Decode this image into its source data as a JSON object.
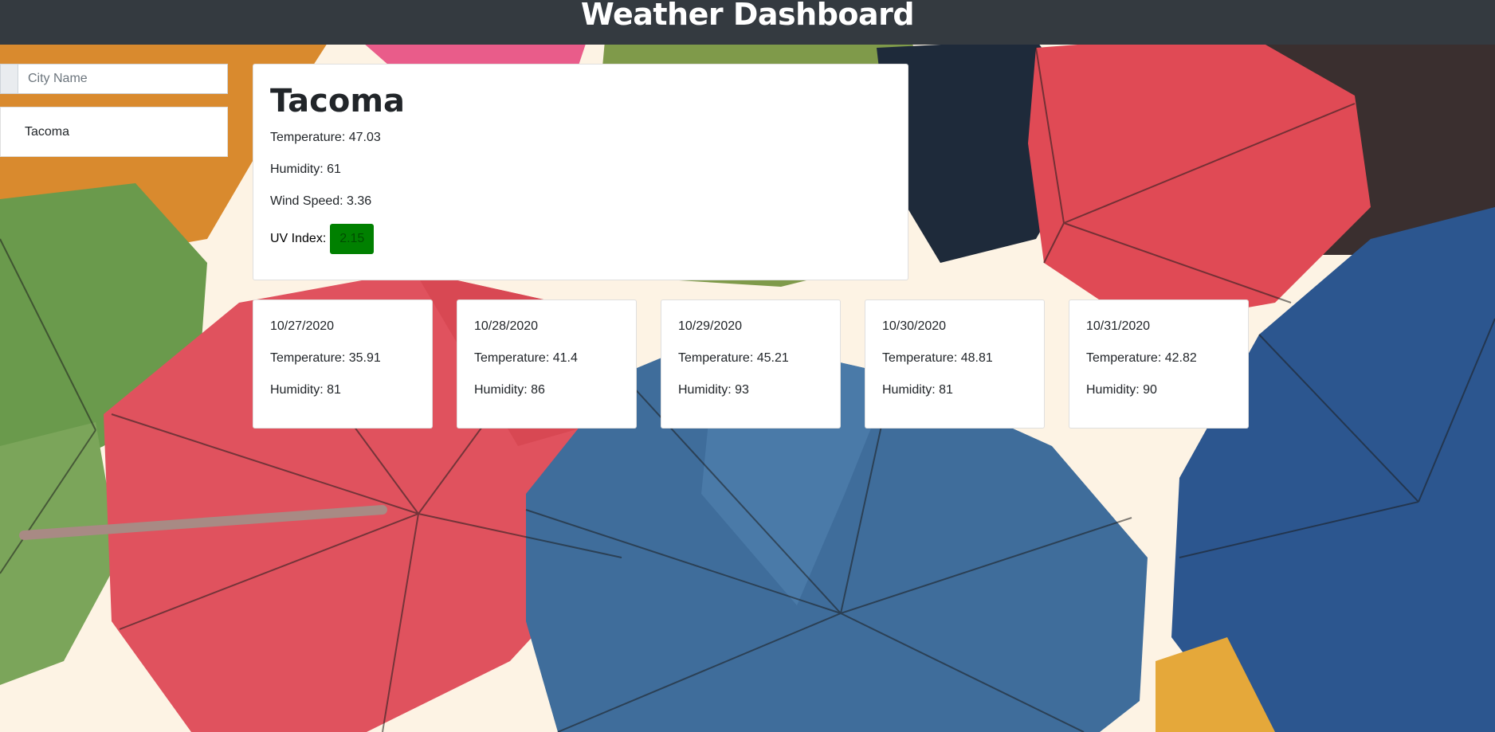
{
  "header": {
    "title": "Weather Dashboard"
  },
  "search": {
    "placeholder": "City Name",
    "value": ""
  },
  "history": {
    "items": [
      {
        "label": "Tacoma"
      }
    ]
  },
  "current": {
    "city": "Tacoma",
    "temperature": "Temperature: 47.03",
    "humidity": "Humidity: 61",
    "wind_speed": "Wind Speed: 3.36",
    "uv_label": "UV Index:",
    "uv_value": "2.15",
    "uv_color": "#008000"
  },
  "forecast": [
    {
      "date": "10/27/2020",
      "temperature": "Temperature: 35.91",
      "humidity": "Humidity: 81"
    },
    {
      "date": "10/28/2020",
      "temperature": "Temperature: 41.4",
      "humidity": "Humidity: 86"
    },
    {
      "date": "10/29/2020",
      "temperature": "Temperature: 45.21",
      "humidity": "Humidity: 93"
    },
    {
      "date": "10/30/2020",
      "temperature": "Temperature: 48.81",
      "humidity": "Humidity: 81"
    },
    {
      "date": "10/31/2020",
      "temperature": "Temperature: 42.82",
      "humidity": "Humidity: 90"
    }
  ],
  "colors": {
    "header_bg": "#343a40",
    "uv_badge": "#008000"
  }
}
